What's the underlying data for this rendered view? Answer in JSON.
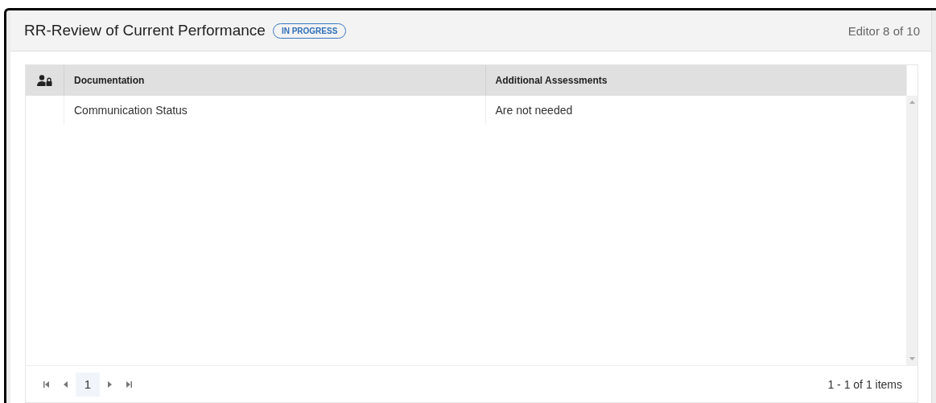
{
  "editor": {
    "title": "RR-Review of Current Performance",
    "status": "IN PROGRESS",
    "position": "Editor 8 of 10"
  },
  "table": {
    "columns": [
      "Documentation",
      "Additional Assessments"
    ],
    "rows": [
      {
        "cells": [
          "Communication Status",
          "Are not needed"
        ]
      }
    ]
  },
  "pager": {
    "pages": [
      {
        "label": "1",
        "selected": true
      }
    ],
    "summary": "1 - 1 of 1 items"
  }
}
